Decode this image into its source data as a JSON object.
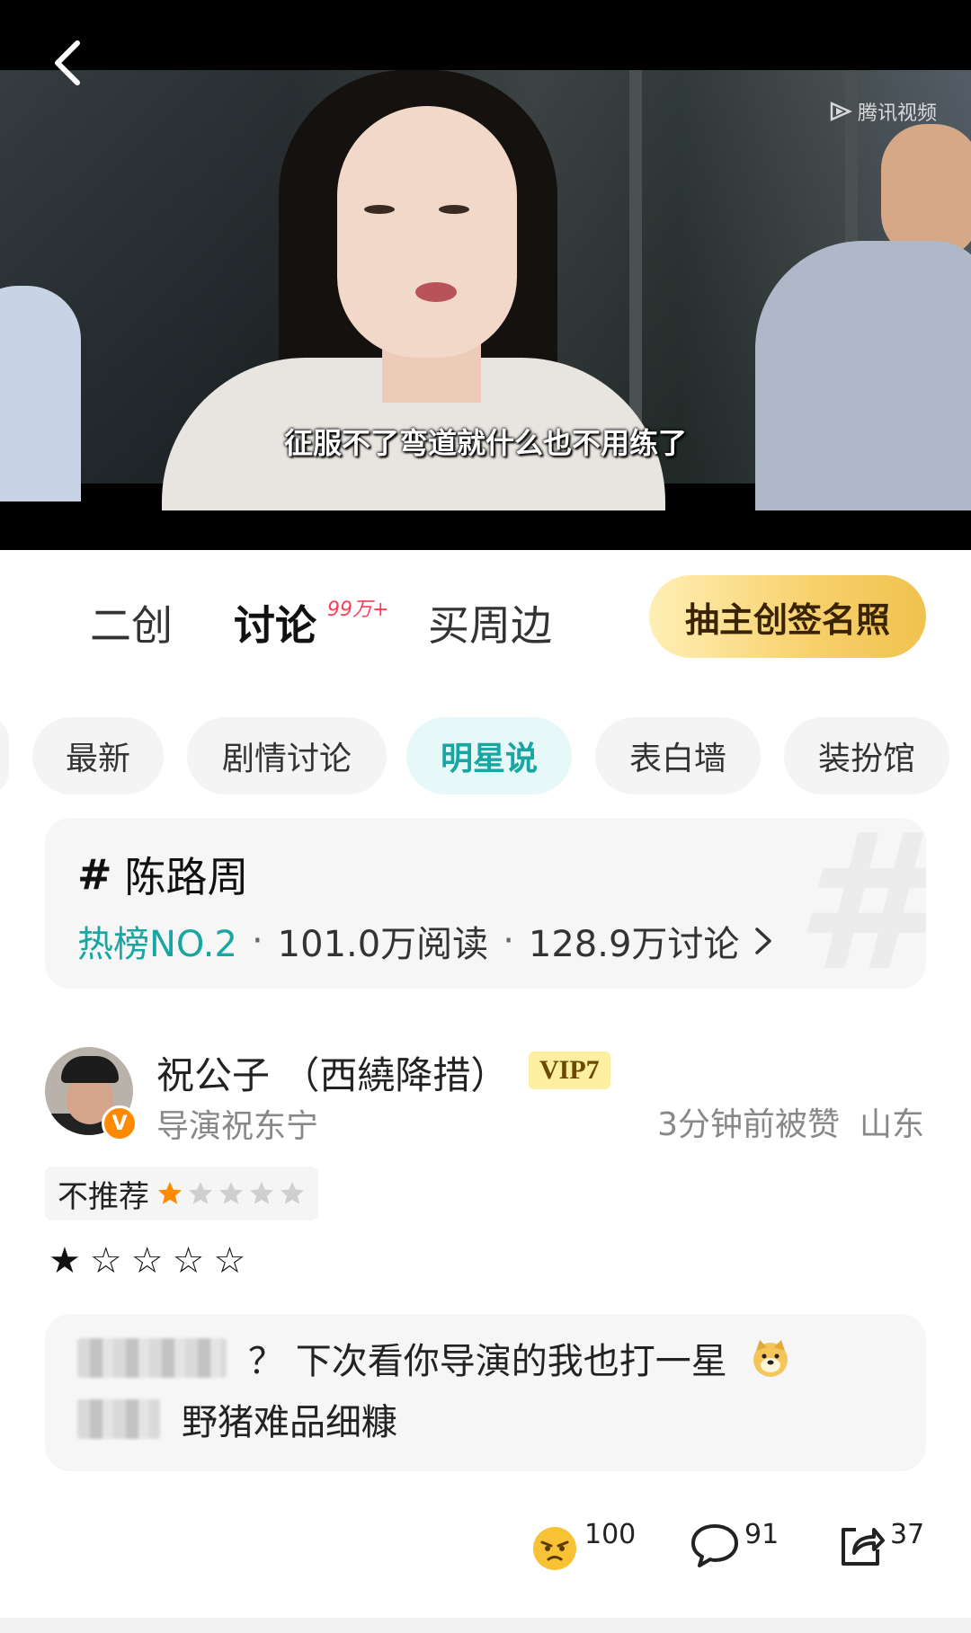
{
  "video": {
    "subtitle": "征服不了弯道就什么也不用练了",
    "watermark": "腾讯视频"
  },
  "tabs": [
    {
      "label": "二创",
      "active": false
    },
    {
      "label": "讨论",
      "active": true,
      "badge": "99万+"
    },
    {
      "label": "买周边",
      "active": false
    }
  ],
  "cta_label": "抽主创签名照",
  "chips": [
    {
      "label": "最新",
      "active": false
    },
    {
      "label": "剧情讨论",
      "active": false
    },
    {
      "label": "明星说",
      "active": true
    },
    {
      "label": "表白墙",
      "active": false
    },
    {
      "label": "装扮馆",
      "active": false
    }
  ],
  "topic": {
    "hash": "#",
    "name": "陈路周",
    "rank": "热榜NO.2",
    "reads": "101.0万阅读",
    "discussions": "128.9万讨论",
    "dot": "·"
  },
  "post": {
    "username": "祝公子 （西繞降措）",
    "vip": "VIP7",
    "subname": "导演祝东宁",
    "time": "3分钟前被赞",
    "location": "山东",
    "rating_label": "不推荐",
    "rating_value": 1,
    "rating_max": 5,
    "star_text": "★☆☆☆☆",
    "accent": "#ff8a00"
  },
  "replies": [
    {
      "text": "？ 下次看你导演的我也打一星"
    },
    {
      "text": "野猪难品细糠"
    }
  ],
  "actions": {
    "reaction_count": "100",
    "comment_count": "91",
    "share_count": "37"
  },
  "colors": {
    "teal": "#19a6a3",
    "gold": "#f0c24f",
    "badge_red": "#ff3d57"
  }
}
